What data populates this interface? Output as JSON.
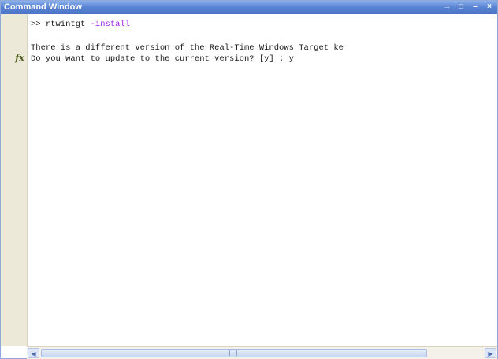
{
  "window": {
    "title": "Command Window",
    "buttons": {
      "undock": "→",
      "maximize": "□",
      "minimize": "–",
      "close": "×"
    }
  },
  "gutter": {
    "fx_icon": "fx"
  },
  "console": {
    "prompt": ">> ",
    "command": "rtwintgt",
    "argument": " -install",
    "output_line_1": "There is a different version of the Real-Time Windows Target ke",
    "output_line_2": "Do you want to update to the current version? [y] : y"
  },
  "scrollbar": {
    "left_arrow": "◀",
    "right_arrow": "▶"
  }
}
